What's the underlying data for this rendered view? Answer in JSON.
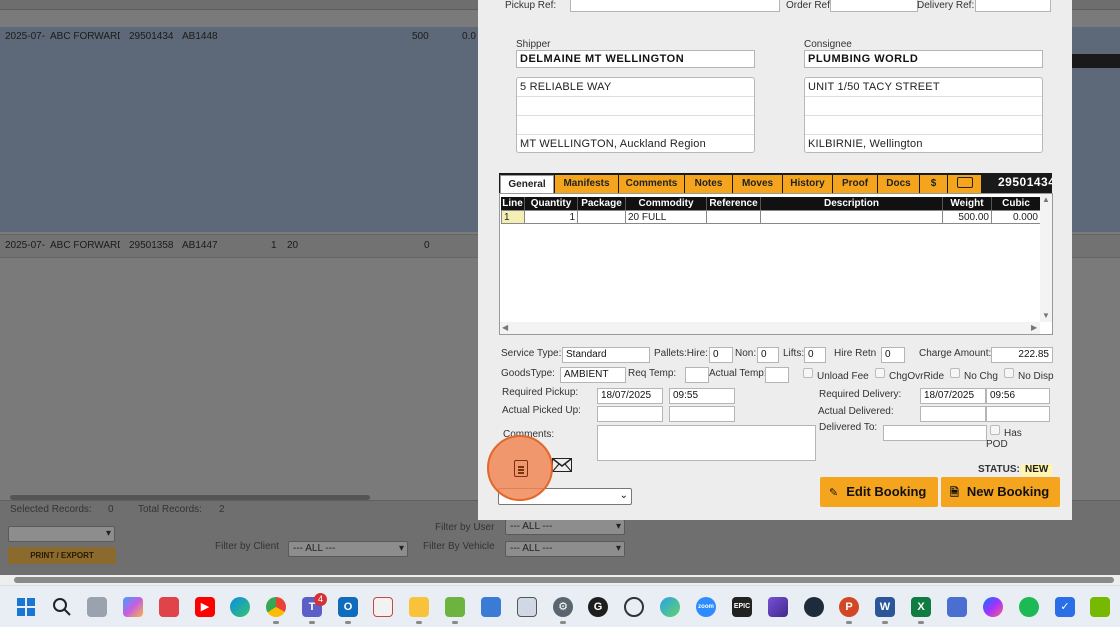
{
  "background": {
    "rows": [
      {
        "date": "2025-07-",
        "client": "ABC FORWARDII",
        "ref": "29501434",
        "vehicle": "AB1448",
        "a": "",
        "b": "",
        "weight": "500",
        "extra": "0.0"
      },
      {
        "date": "2025-07-",
        "client": "ABC FORWARDII",
        "ref": "29501358",
        "vehicle": "AB1447",
        "a": "1",
        "b": "20",
        "weight": "0",
        "extra": ""
      }
    ],
    "selected_records_label": "Selected Records:",
    "selected_records_value": "0",
    "total_records_label": "Total Records:",
    "total_records_value": "2",
    "print_export_label": "PRINT / EXPORT",
    "filter_by_user_label": "Filter by User",
    "filter_by_user_value": "--- ALL ---",
    "filter_by_client_label": "Filter by Client",
    "filter_by_client_value": "--- ALL ---",
    "filter_by_vehicle_label": "Filter By Vehicle",
    "filter_by_vehicle_value": "--- ALL ---"
  },
  "modal": {
    "pickup_ref_label": "Pickup Ref:",
    "order_ref_label": "Order Ref",
    "delivery_ref_label": "Delivery Ref:",
    "shipper_label": "Shipper",
    "shipper_name": "DELMAINE MT WELLINGTON",
    "shipper_address": [
      "5 RELIABLE WAY",
      "",
      "",
      "MT WELLINGTON, Auckland Region"
    ],
    "consignee_label": "Consignee",
    "consignee_name": "PLUMBING WORLD",
    "consignee_address": [
      "UNIT 1/50 TACY STREET",
      "",
      "",
      "KILBIRNIE, Wellington"
    ],
    "tabs": [
      "General",
      "Manifests",
      "Comments",
      "Notes",
      "Moves",
      "History",
      "Proof",
      "Docs",
      "$"
    ],
    "booking_number": "29501434",
    "grid_headers": [
      "Line",
      "Quantity",
      "Package",
      "Commodity",
      "Reference",
      "Description",
      "Weight",
      "Cubic"
    ],
    "grid_rows": [
      {
        "line": "1",
        "quantity": "1",
        "package": "",
        "commodity": "20 FULL",
        "reference": "",
        "description": "",
        "weight": "500.00",
        "cubic": "0.000"
      }
    ],
    "service_type_label": "Service Type:",
    "service_type_value": "Standard",
    "pallets_hire_label": "Pallets:Hire:",
    "pallets_hire_value": "0",
    "non_label": "Non:",
    "non_value": "0",
    "lifts_label": "Lifts:",
    "lifts_value": "0",
    "hire_retn_label": "Hire Retn",
    "hire_retn_value": "0",
    "charge_amount_label": "Charge Amount:",
    "charge_amount_value": "222.85",
    "goods_type_label": "GoodsType:",
    "goods_type_value": "AMBIENT",
    "req_temp_label": "Req Temp:",
    "actual_temp_label": "Actual Temp:",
    "unload_fee_label": "Unload Fee",
    "chg_ovr_ride_label": "ChgOvrRide",
    "no_chg_label": "No Chg",
    "no_disp_label": "No Disp",
    "required_pickup_label": "Required Pickup:",
    "required_pickup_date": "18/07/2025",
    "required_pickup_time": "09:55",
    "actual_picked_up_label": "Actual Picked Up:",
    "required_delivery_label": "Required Delivery:",
    "required_delivery_date": "18/07/2025",
    "required_delivery_time": "09:56",
    "actual_delivered_label": "Actual Delivered:",
    "delivered_to_label": "Delivered To:",
    "has_pod_label": "Has POD",
    "comments_label": "Comments:",
    "status_label": "STATUS:",
    "status_value": "NEW",
    "edit_booking_label": "Edit Booking",
    "new_booking_label": "New Booking"
  },
  "taskbar": {
    "teams_badge": "4",
    "icons": [
      "windows-start",
      "search",
      "task-view",
      "copilot",
      "app-red",
      "youtube",
      "edge",
      "chrome",
      "teams",
      "outlook",
      "app-docs",
      "file-explorer",
      "notepad",
      "app-blue",
      "app-window",
      "settings",
      "app-g",
      "app-circle",
      "app-globe",
      "zoom",
      "epic-games",
      "app-purple",
      "app-gauge",
      "powerpoint",
      "word",
      "excel",
      "app-people",
      "messenger",
      "spotify",
      "app-check",
      "nvidia"
    ],
    "epic_label": "EPIC",
    "zoom_label": "zoom"
  }
}
